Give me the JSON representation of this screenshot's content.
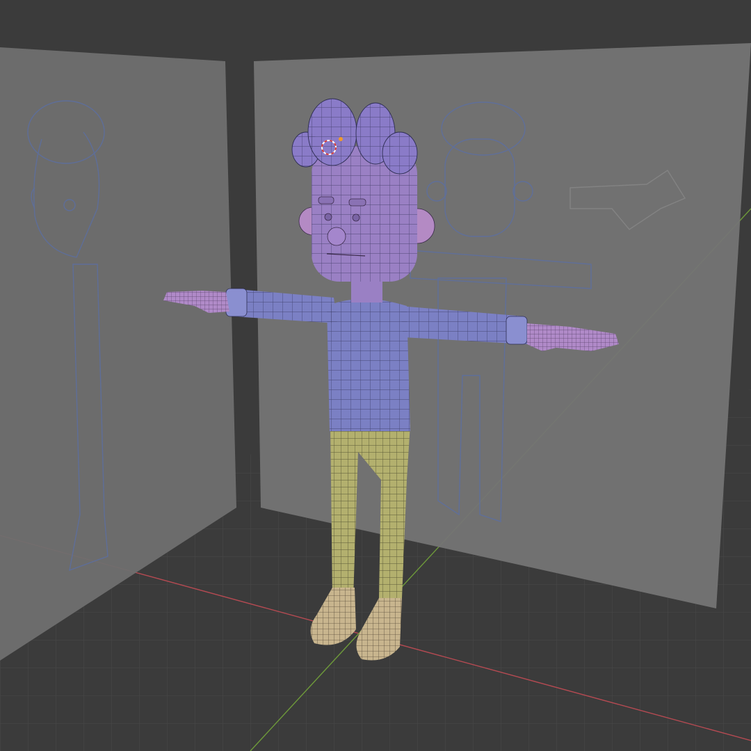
{
  "viewport": {
    "mode": "3d-viewport",
    "shading": "solid-with-wireframe",
    "background_color": "#3a3a3a",
    "floor_grid": true,
    "axis_x_color": "#b54a52",
    "axis_y_color": "#6e9a3a"
  },
  "reference_planes": [
    {
      "view": "side",
      "color": "#6f6f6f",
      "sketch_color": "#5a6fa8"
    },
    {
      "view": "front",
      "color": "#747474",
      "sketch_color": "#5a6fa8"
    }
  ],
  "model": {
    "pose": "T-pose",
    "parts": [
      {
        "part": "hair",
        "color": "#8a7bc8"
      },
      {
        "part": "head",
        "color": "#9a80c4"
      },
      {
        "part": "ears",
        "color": "#b48ac4"
      },
      {
        "part": "sweater",
        "color": "#7b80c4"
      },
      {
        "part": "hands",
        "color": "#b08ac8"
      },
      {
        "part": "pants",
        "color": "#b3b06e"
      },
      {
        "part": "shoes",
        "color": "#c8b58e"
      }
    ]
  },
  "cursor_3d": {
    "icon": "3d-cursor-icon",
    "color": "#d23a3a"
  },
  "origin_point": {
    "icon": "origin-dot-icon",
    "color": "#f09a2a"
  }
}
